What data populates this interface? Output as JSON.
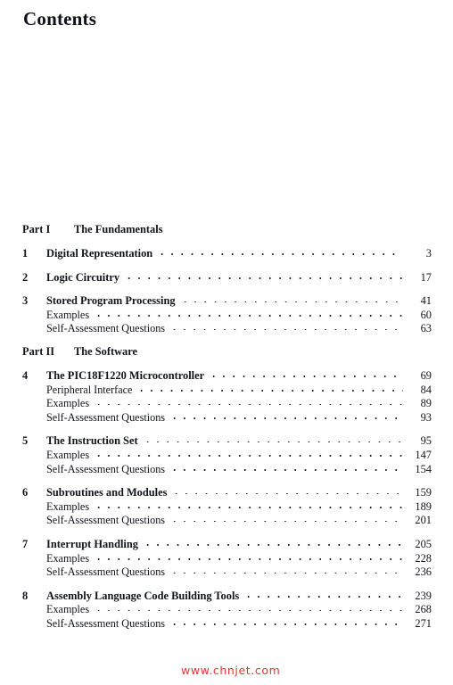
{
  "page": {
    "title": "Contents",
    "background_color": "#ffffff",
    "text_color": "#12141c"
  },
  "watermark": {
    "text": "www.chnjet.com",
    "color": "#ee1c22"
  },
  "toc": {
    "parts": [
      {
        "label": "Part I",
        "name": "The Fundamentals",
        "chapters": [
          {
            "number": "1",
            "title": "Digital Representation",
            "page": "3",
            "subentries": []
          },
          {
            "number": "2",
            "title": "Logic Circuitry",
            "page": "17",
            "subentries": []
          },
          {
            "number": "3",
            "title": "Stored Program Processing",
            "page": "41",
            "subentries": [
              {
                "title": "Examples",
                "page": "60"
              },
              {
                "title": "Self-Assessment Questions",
                "page": "63"
              }
            ]
          }
        ]
      },
      {
        "label": "Part II",
        "name": "The Software",
        "chapters": [
          {
            "number": "4",
            "title": "The PIC18F1220 Microcontroller",
            "page": "69",
            "subentries": [
              {
                "title": "Peripheral Interface",
                "page": "84"
              },
              {
                "title": "Examples",
                "page": "89"
              },
              {
                "title": "Self-Assessment Questions",
                "page": "93"
              }
            ]
          },
          {
            "number": "5",
            "title": "The Instruction Set",
            "page": "95",
            "subentries": [
              {
                "title": "Examples",
                "page": "147"
              },
              {
                "title": "Self-Assessment Questions",
                "page": "154"
              }
            ]
          },
          {
            "number": "6",
            "title": "Subroutines and Modules",
            "page": "159",
            "subentries": [
              {
                "title": "Examples",
                "page": "189"
              },
              {
                "title": "Self-Assessment Questions",
                "page": "201"
              }
            ]
          },
          {
            "number": "7",
            "title": "Interrupt Handling",
            "page": "205",
            "subentries": [
              {
                "title": "Examples",
                "page": "228"
              },
              {
                "title": "Self-Assessment Questions",
                "page": "236"
              }
            ]
          },
          {
            "number": "8",
            "title": "Assembly Language Code Building Tools",
            "page": "239",
            "subentries": [
              {
                "title": "Examples",
                "page": "268"
              },
              {
                "title": "Self-Assessment Questions",
                "page": "271"
              }
            ]
          }
        ]
      }
    ]
  }
}
